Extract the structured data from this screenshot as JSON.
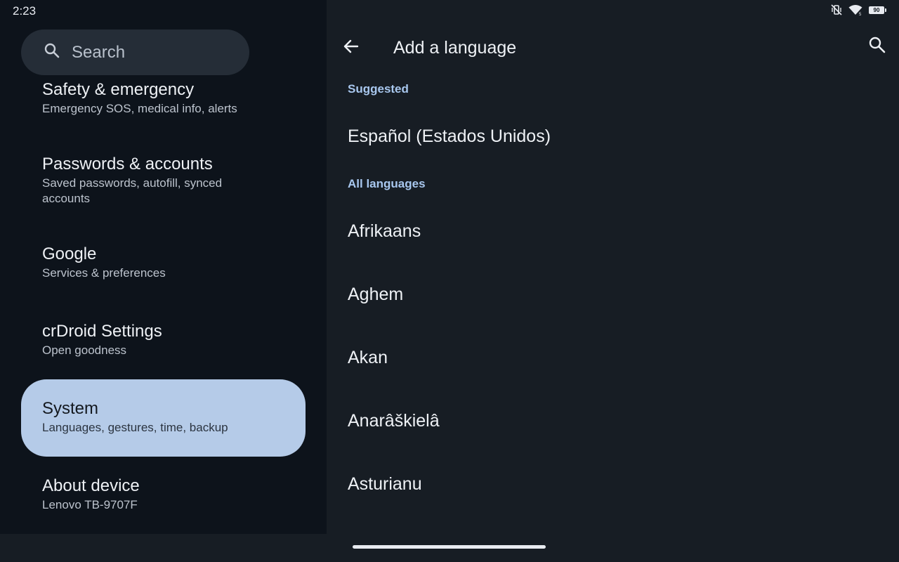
{
  "status_bar": {
    "time": "2:23",
    "battery_level": "90",
    "icons": [
      "vibrate-off-icon",
      "wifi-icon",
      "battery-icon"
    ]
  },
  "sidebar": {
    "search_placeholder": "Search",
    "items": [
      {
        "title": "Safety & emergency",
        "subtitle": "Emergency SOS, medical info, alerts",
        "selected": false
      },
      {
        "title": "Passwords & accounts",
        "subtitle": "Saved passwords, autofill, synced accounts",
        "selected": false
      },
      {
        "title": "Google",
        "subtitle": "Services & preferences",
        "selected": false
      },
      {
        "title": "crDroid Settings",
        "subtitle": "Open goodness",
        "selected": false
      },
      {
        "title": "System",
        "subtitle": "Languages, gestures, time, backup",
        "selected": true
      },
      {
        "title": "About device",
        "subtitle": "Lenovo TB-9707F",
        "selected": false
      }
    ]
  },
  "main": {
    "title": "Add a language",
    "suggested_header": "Suggested",
    "suggested": [
      "Español (Estados Unidos)"
    ],
    "all_header": "All languages",
    "languages": [
      "Afrikaans",
      "Aghem",
      "Akan",
      "Anarâškielâ",
      "Asturianu"
    ]
  },
  "colors": {
    "selected_item_bg": "#b5cbe8",
    "section_header": "#a8c7ee",
    "sidebar_bg": "#0d131b",
    "content_bg": "#171d24"
  }
}
